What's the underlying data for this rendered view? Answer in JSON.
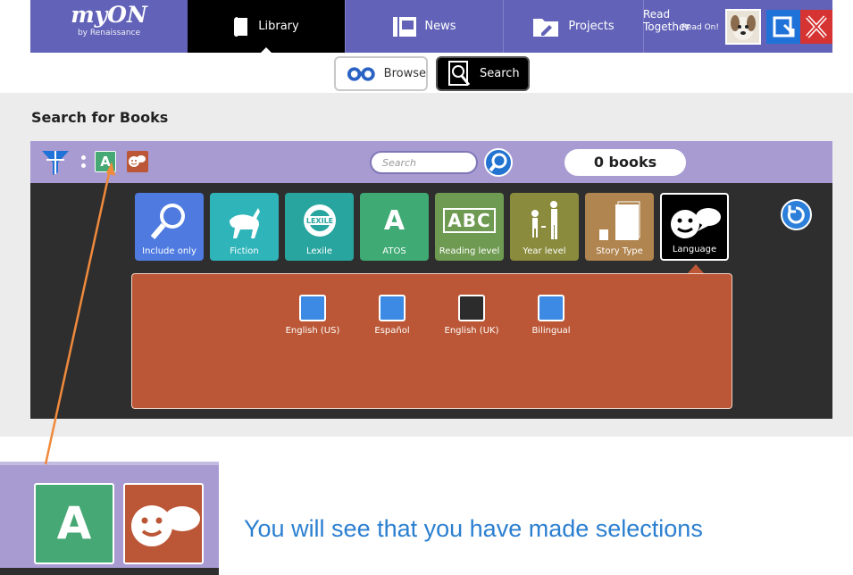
{
  "nav": {
    "logo_brand": "myON",
    "logo_sub": "by Renaissance",
    "tabs": [
      {
        "label": "Library",
        "icon": "book-icon"
      },
      {
        "label": "News",
        "icon": "newspaper-icon"
      },
      {
        "label": "Projects",
        "icon": "projects-folder-icon"
      }
    ],
    "active_tab": "Library",
    "user_title": "Read Together",
    "user_subtitle": "Read On!"
  },
  "subnav": {
    "browse_label": "Browse",
    "search_label": "Search",
    "active": "Search"
  },
  "main": {
    "heading": "Search for Books",
    "search_placeholder": "Search",
    "book_count": "0 books",
    "filter_chip_a": "A",
    "tiles": [
      {
        "label": "Include only",
        "color": "#4f7be0",
        "icon": "magnifier-title-icon"
      },
      {
        "label": "Fiction",
        "color": "#2fb4b9",
        "icon": "unicorn-icon"
      },
      {
        "label": "Lexile",
        "color": "#29a5a0",
        "icon": "lexile-icon"
      },
      {
        "label": "ATOS",
        "color": "#3faa74",
        "icon": "atos-a-icon",
        "glyph": "A"
      },
      {
        "label": "Reading level",
        "color": "#6e9a51",
        "icon": "abc-blocks-icon",
        "glyph": "ABC"
      },
      {
        "label": "Year level",
        "color": "#8a8b3c",
        "icon": "year-level-figures-icon"
      },
      {
        "label": "Story Type",
        "color": "#b1854f",
        "icon": "story-type-books-icon"
      },
      {
        "label": "Language",
        "color": "#000000",
        "icon": "language-speech-icon",
        "selected": true
      }
    ],
    "languages": [
      {
        "label": "English (US)",
        "checked": false
      },
      {
        "label": "Español",
        "checked": false
      },
      {
        "label": "English (UK)",
        "checked": true
      },
      {
        "label": "Bilingual",
        "checked": false
      }
    ]
  },
  "callout": {
    "zoom_chip_a": "A",
    "caption": "You will see that you have made selections",
    "caption_color": "#2b7fd0",
    "arrow_color": "#f08a3c"
  }
}
